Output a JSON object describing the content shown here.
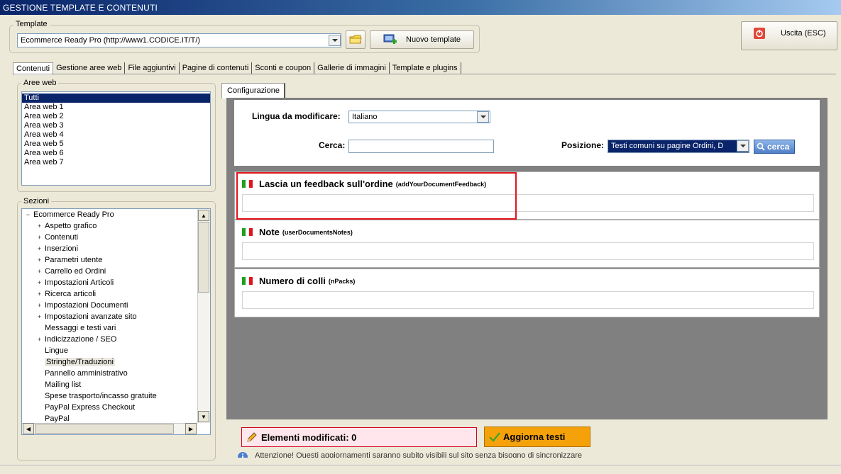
{
  "window": {
    "title": "GESTIONE TEMPLATE E CONTENUTI"
  },
  "template": {
    "legend": "Template",
    "selected": "Ecommerce Ready Pro (http://www1.CODICE.IT/T/)",
    "new_button": "Nuovo template"
  },
  "exit_button": "Uscita (ESC)",
  "tabs": [
    "Contenuti",
    "Gestione aree web",
    "File aggiuntivi",
    "Pagine di contenuti",
    "Sconti e coupon",
    "Gallerie di immagini",
    "Template e plugins"
  ],
  "areas": {
    "legend": "Aree web",
    "items": [
      "Tutti",
      "Area web 1",
      "Area web 2",
      "Area web 3",
      "Area web 4",
      "Area web 5",
      "Area web 6",
      "Area web 7"
    ],
    "selected_index": 0
  },
  "sections": {
    "legend": "Sezioni",
    "root": "Ecommerce Ready Pro",
    "items": [
      {
        "label": "Aspetto grafico",
        "expand": true
      },
      {
        "label": "Contenuti",
        "expand": true
      },
      {
        "label": "Inserzioni",
        "expand": true
      },
      {
        "label": "Parametri utente",
        "expand": true
      },
      {
        "label": "Carrello ed Ordini",
        "expand": true
      },
      {
        "label": "Impostazioni Articoli",
        "expand": true
      },
      {
        "label": "Ricerca articoli",
        "expand": true
      },
      {
        "label": "Impostazioni Documenti",
        "expand": true
      },
      {
        "label": "Impostazioni avanzate sito",
        "expand": true
      },
      {
        "label": "Messaggi e testi vari",
        "expand": false
      },
      {
        "label": "Indicizzazione / SEO",
        "expand": true
      },
      {
        "label": "Lingue",
        "expand": false
      },
      {
        "label": "Stringhe/Traduzioni",
        "expand": false,
        "selected": true
      },
      {
        "label": "Pannello amministrativo",
        "expand": false
      },
      {
        "label": "Mailing list",
        "expand": false
      },
      {
        "label": "Spese trasporto/incasso gratuite",
        "expand": false
      },
      {
        "label": "PayPal Express Checkout",
        "expand": false
      },
      {
        "label": "PayPal",
        "expand": false
      }
    ]
  },
  "config": {
    "tab": "Configurazione",
    "language_label": "Lingua da modificare:",
    "language_value": "Italiano",
    "search_label": "Cerca:",
    "search_value": "",
    "position_label": "Posizione:",
    "position_value": "Testi comuni su pagine Ordini, D",
    "search_button": "cerca"
  },
  "fields": [
    {
      "title": "Lascia un feedback sull'ordine",
      "key": "(addYourDocumentFeedback)",
      "value": "",
      "highlighted": true
    },
    {
      "title": "Note",
      "key": "(userDocumentsNotes)",
      "value": "",
      "highlighted": false
    },
    {
      "title": "Numero di colli",
      "key": "(nPacks)",
      "value": "",
      "highlighted": false
    }
  ],
  "footer": {
    "modified_label": "Elementi modificati: 0",
    "update_button": "Aggiorna testi",
    "warning": "Attenzione! Questi aggiornamenti saranno subito visibili sul sito senza bisogno di sincronizzare"
  },
  "colors": {
    "title_bar": "#0a246a",
    "selection": "#0a246a",
    "highlight_border": "#e0141e",
    "update_button": "#f5a20a",
    "modified_bg": "#ffe6ec"
  },
  "icons": [
    "folder-icon",
    "add-template-icon",
    "power-icon",
    "italian-flag-icon",
    "search-icon",
    "pencil-icon",
    "check-icon",
    "info-icon"
  ]
}
